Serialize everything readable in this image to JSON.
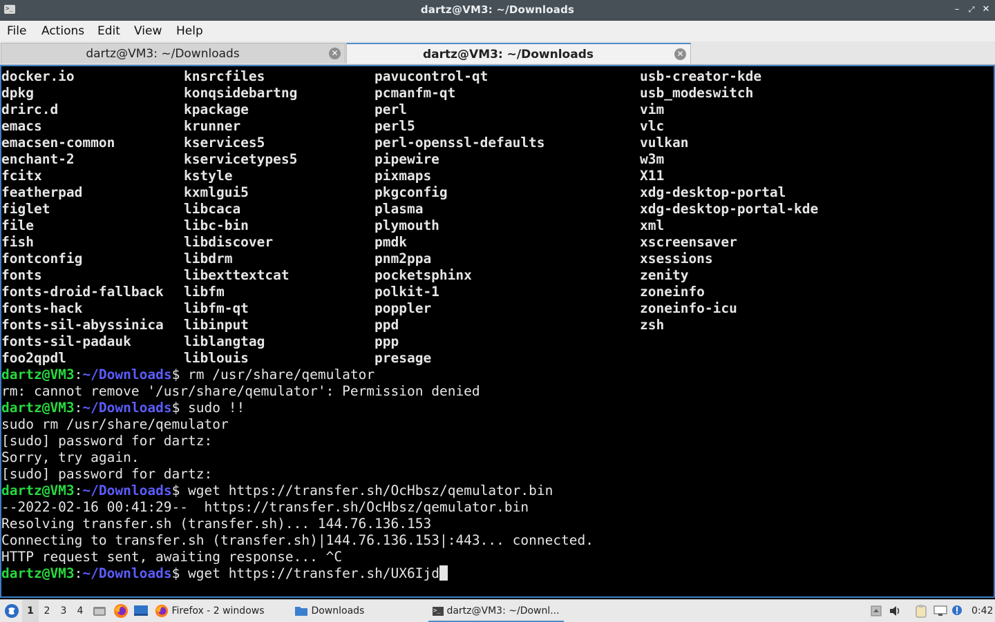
{
  "window": {
    "title": "dartz@VM3: ~/Downloads"
  },
  "menu": [
    "File",
    "Actions",
    "Edit",
    "View",
    "Help"
  ],
  "tabs": [
    {
      "label": "dartz@VM3: ~/Downloads",
      "active": false
    },
    {
      "label": "dartz@VM3: ~/Downloads",
      "active": true
    }
  ],
  "terminal": {
    "dir_columns": [
      [
        "docker.io",
        "dpkg",
        "drirc.d",
        "emacs",
        "emacsen-common",
        "enchant-2",
        "fcitx",
        "featherpad",
        "figlet",
        "file",
        "fish",
        "fontconfig",
        "fonts",
        "fonts-droid-fallback",
        "fonts-hack",
        "fonts-sil-abyssinica",
        "fonts-sil-padauk",
        "foo2qpdl"
      ],
      [
        "knsrcfiles",
        "konqsidebartng",
        "kpackage",
        "krunner",
        "kservices5",
        "kservicetypes5",
        "kstyle",
        "kxmlgui5",
        "libcaca",
        "libc-bin",
        "libdiscover",
        "libdrm",
        "libexttextcat",
        "libfm",
        "libfm-qt",
        "libinput",
        "liblangtag",
        "liblouis"
      ],
      [
        "pavucontrol-qt",
        "pcmanfm-qt",
        "perl",
        "perl5",
        "perl-openssl-defaults",
        "pipewire",
        "pixmaps",
        "pkgconfig",
        "plasma",
        "plymouth",
        "pmdk",
        "pnm2ppa",
        "pocketsphinx",
        "polkit-1",
        "poppler",
        "ppd",
        "ppp",
        "presage"
      ],
      [
        "usb-creator-kde",
        "usb_modeswitch",
        "vim",
        "vlc",
        "vulkan",
        "w3m",
        "X11",
        "xdg-desktop-portal",
        "xdg-desktop-portal-kde",
        "xml",
        "xscreensaver",
        "xsessions",
        "zenity",
        "zoneinfo",
        "zoneinfo-icu",
        "zsh"
      ]
    ],
    "prompt": {
      "user": "dartz@VM3",
      "sep": ":",
      "path": "~/Downloads",
      "symbol": "$"
    },
    "lines": [
      {
        "prompt": true,
        "text": " rm /usr/share/qemulator"
      },
      {
        "prompt": false,
        "text": "rm: cannot remove '/usr/share/qemulator': Permission denied"
      },
      {
        "prompt": true,
        "text": " sudo !!"
      },
      {
        "prompt": false,
        "text": "sudo rm /usr/share/qemulator"
      },
      {
        "prompt": false,
        "text": "[sudo] password for dartz:"
      },
      {
        "prompt": false,
        "text": "Sorry, try again."
      },
      {
        "prompt": false,
        "text": "[sudo] password for dartz:"
      },
      {
        "prompt": true,
        "text": " wget https://transfer.sh/OcHbsz/qemulator.bin"
      },
      {
        "prompt": false,
        "text": "--2022-02-16 00:41:29--  https://transfer.sh/OcHbsz/qemulator.bin"
      },
      {
        "prompt": false,
        "text": "Resolving transfer.sh (transfer.sh)... 144.76.136.153"
      },
      {
        "prompt": false,
        "text": "Connecting to transfer.sh (transfer.sh)|144.76.136.153|:443... connected."
      },
      {
        "prompt": false,
        "text": "HTTP request sent, awaiting response... ^C"
      },
      {
        "prompt": true,
        "text": " wget https://transfer.sh/UX6Ijd",
        "cursor": true
      }
    ]
  },
  "taskbar": {
    "workspaces": [
      "1",
      "2",
      "3",
      "4"
    ],
    "active_workspace": "1",
    "tasks": [
      "Firefox - 2 windows",
      "Downloads",
      "dartz@VM3: ~/Downl..."
    ],
    "clock": "0:42"
  },
  "colors": {
    "dir": "#5c5cff",
    "user": "#27d93f",
    "accent": "#3d7fc7",
    "titlebar": "#475057"
  },
  "icons": [
    "terminal-icon",
    "minimize-icon",
    "maximize-icon",
    "close-icon",
    "tab-close-icon",
    "app-menu-icon",
    "file-manager-icon",
    "firefox-icon",
    "desktop-icon",
    "folder-icon",
    "updates-icon",
    "volume-icon",
    "clipboard-icon",
    "network-icon",
    "notification-icon"
  ]
}
